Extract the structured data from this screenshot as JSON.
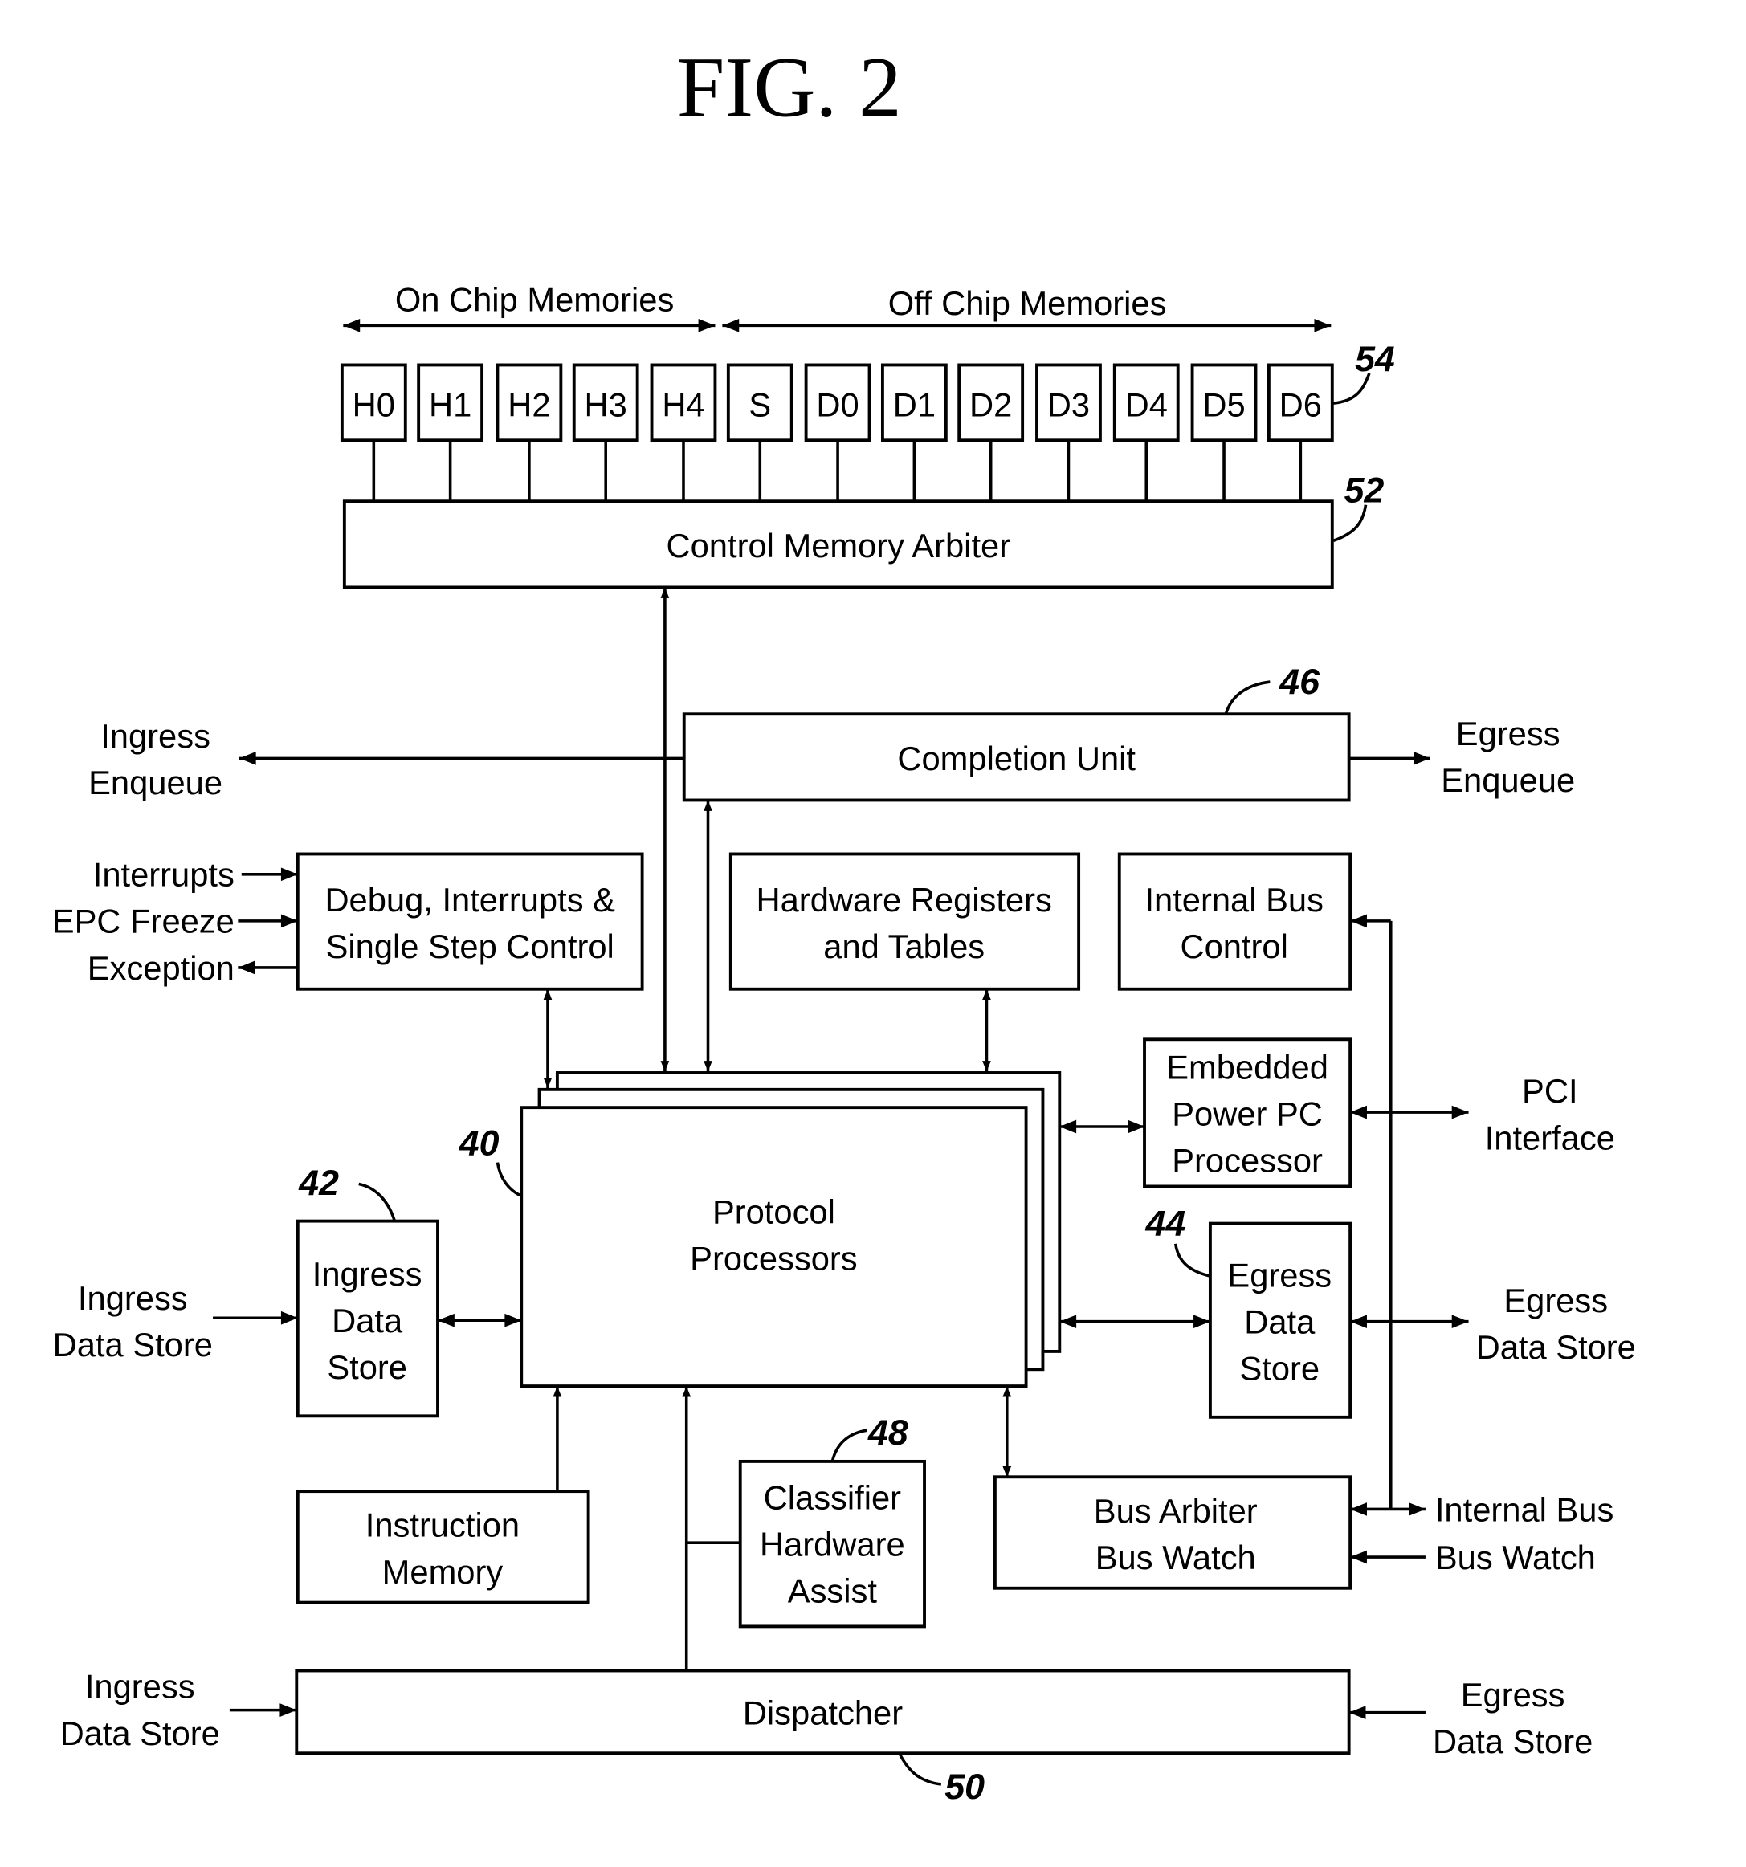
{
  "title": "FIG. 2",
  "ranges": {
    "on_chip": "On Chip Memories",
    "off_chip": "Off Chip Memories"
  },
  "memories": [
    "H0",
    "H1",
    "H2",
    "H3",
    "H4",
    "S",
    "D0",
    "D1",
    "D2",
    "D3",
    "D4",
    "D5",
    "D6"
  ],
  "blocks": {
    "control_memory_arbiter": "Control Memory Arbiter",
    "completion_unit": "Completion Unit",
    "debug": [
      "Debug, Interrupts &",
      "Single Step Control"
    ],
    "hw_registers": [
      "Hardware Registers",
      "and Tables"
    ],
    "internal_bus_control": [
      "Internal Bus",
      "Control"
    ],
    "embedded_ppc": [
      "Embedded",
      "Power PC",
      "Processor"
    ],
    "protocol_processors": [
      "Protocol",
      "Processors"
    ],
    "ingress_data_store": [
      "Ingress",
      "Data",
      "Store"
    ],
    "egress_data_store": [
      "Egress",
      "Data",
      "Store"
    ],
    "instruction_memory": [
      "Instruction",
      "Memory"
    ],
    "classifier": [
      "Classifier",
      "Hardware",
      "Assist"
    ],
    "bus_arbiter": [
      "Bus Arbiter",
      "Bus Watch"
    ],
    "dispatcher": "Dispatcher"
  },
  "external": {
    "ingress_enqueue": [
      "Ingress",
      "Enqueue"
    ],
    "egress_enqueue": [
      "Egress",
      "Enqueue"
    ],
    "interrupts": "Interrupts",
    "epc_freeze": "EPC Freeze",
    "exception": "Exception",
    "pci": [
      "PCI",
      "Interface"
    ],
    "ingress_ds_left": [
      "Ingress",
      "Data Store"
    ],
    "egress_ds_right": [
      "Egress",
      "Data Store"
    ],
    "internal_bus": "Internal Bus",
    "bus_watch": "Bus Watch",
    "ingress_ds_bottom": [
      "Ingress",
      "Data Store"
    ],
    "egress_ds_bottom": [
      "Egress",
      "Data Store"
    ]
  },
  "refs": {
    "r54": "54",
    "r52": "52",
    "r46": "46",
    "r40": "40",
    "r42": "42",
    "r44": "44",
    "r48": "48",
    "r50": "50"
  }
}
